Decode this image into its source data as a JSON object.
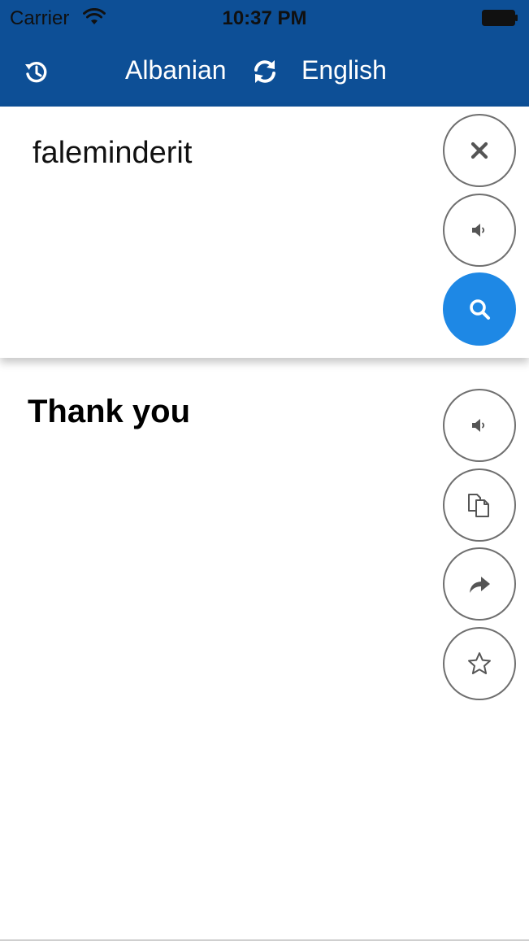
{
  "status_bar": {
    "carrier": "Carrier",
    "time": "10:37 PM",
    "icons": [
      "wifi-icon",
      "battery-icon"
    ]
  },
  "nav": {
    "source_language": "Albanian",
    "target_language": "English",
    "icons": [
      "history-icon",
      "swap-languages-icon"
    ]
  },
  "input": {
    "text": "faleminderit",
    "buttons": [
      "clear-icon",
      "speaker-icon",
      "search-icon"
    ]
  },
  "output": {
    "text": "Thank you",
    "buttons": [
      "speaker-icon",
      "copy-icon",
      "share-icon",
      "star-icon"
    ]
  },
  "colors": {
    "header": "#0d4f96",
    "accent": "#1e88e5",
    "icon": "#555555"
  }
}
